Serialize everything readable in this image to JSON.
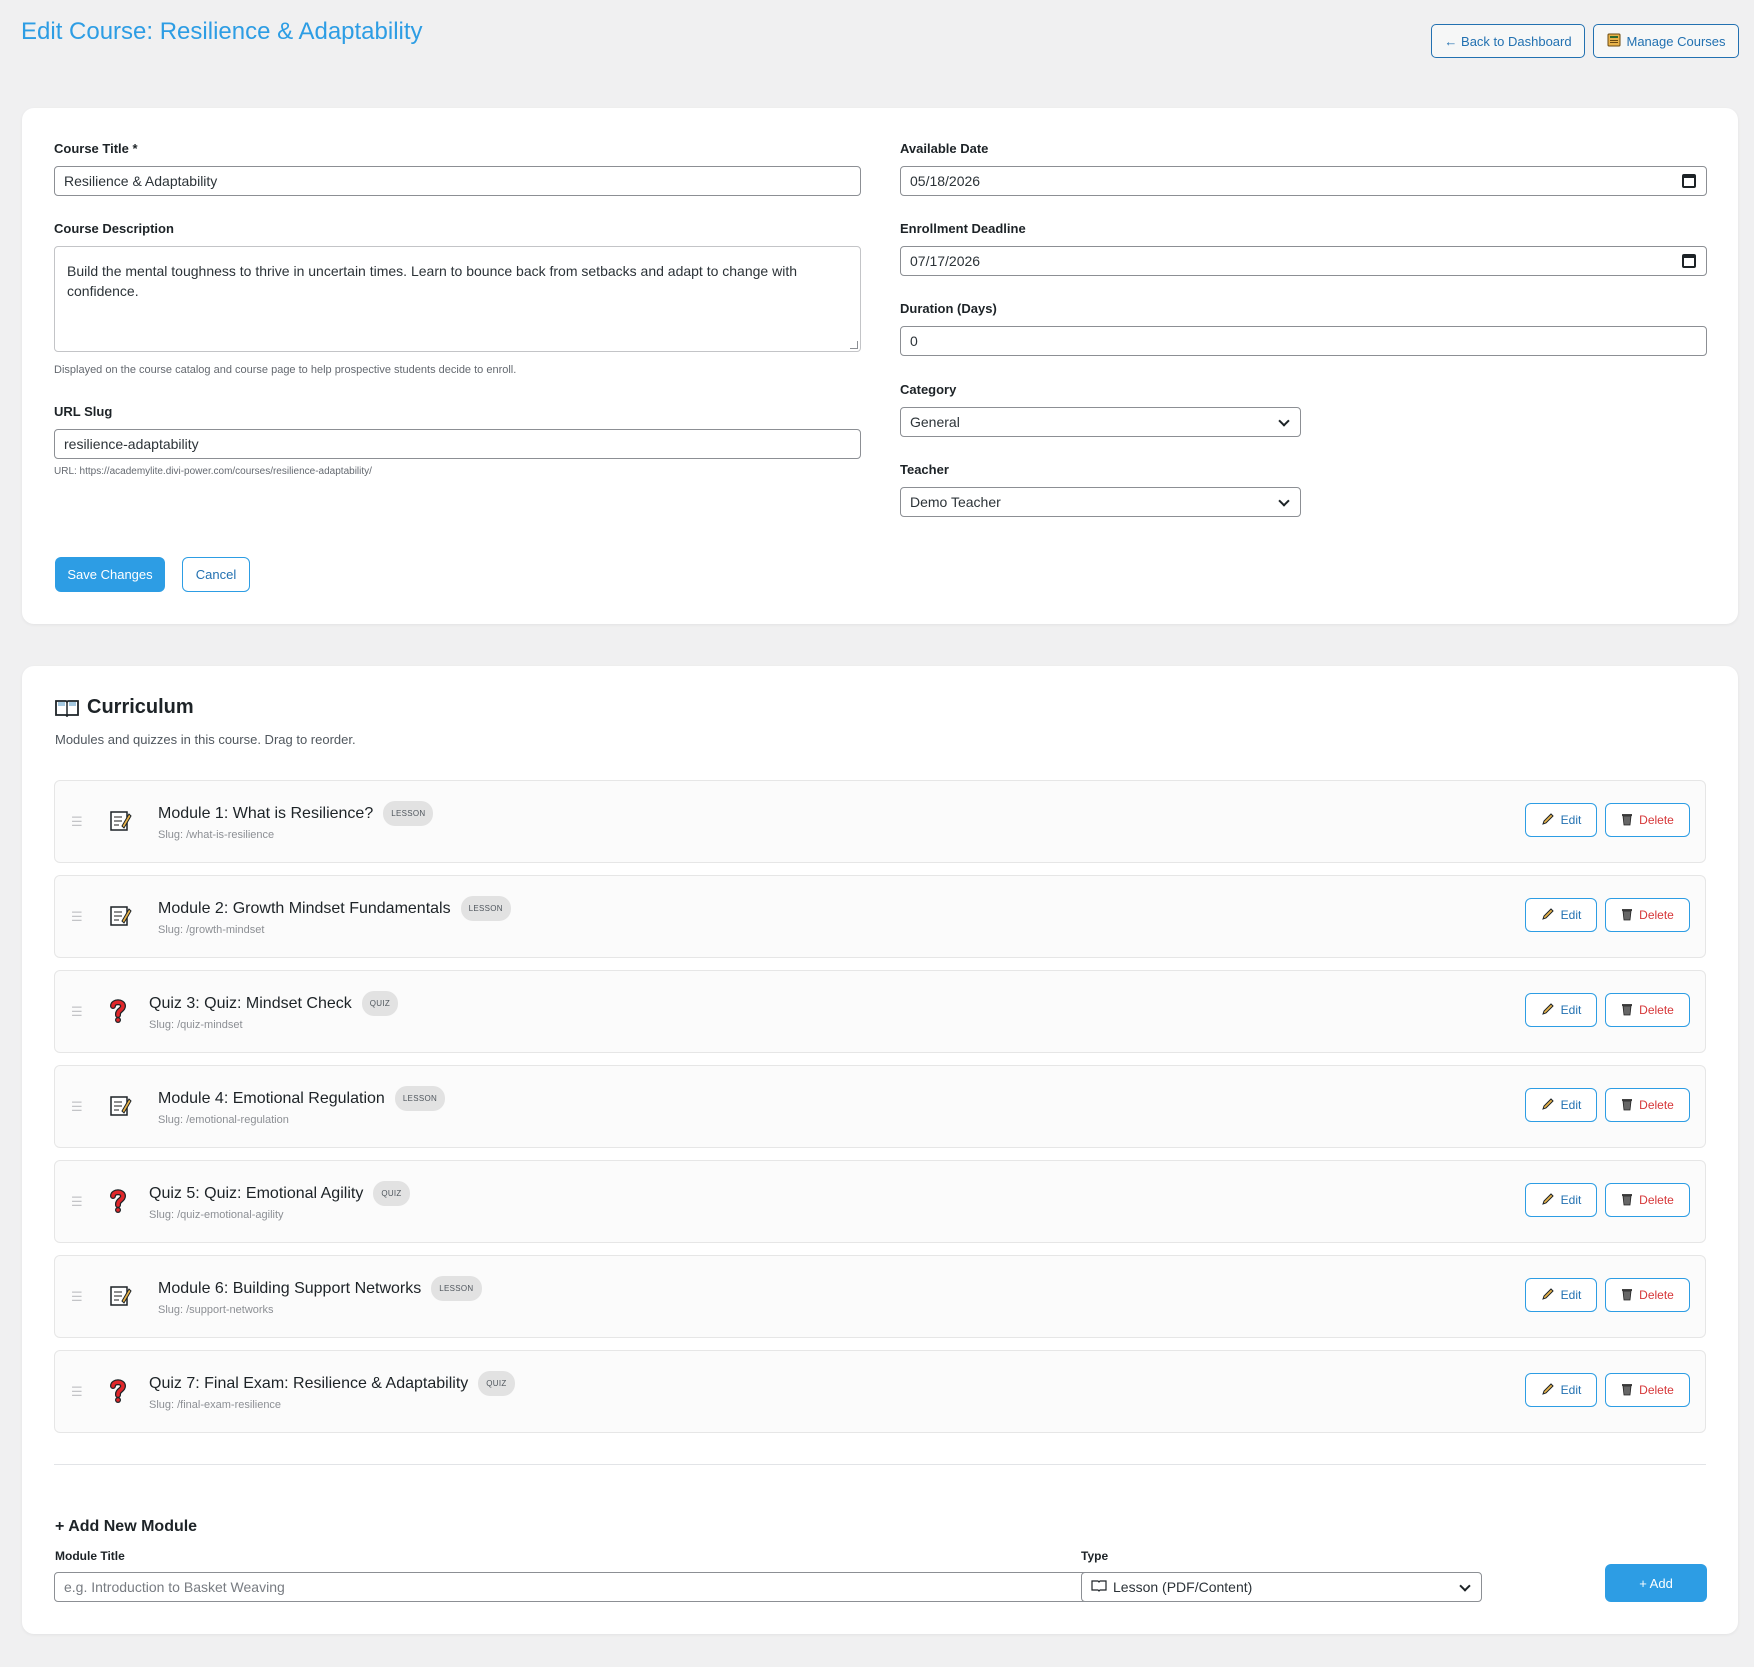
{
  "header": {
    "title": "Edit Course: Resilience & Adaptability",
    "back_label": "← Back to Dashboard",
    "manage_label": "Manage Courses"
  },
  "form": {
    "course_title_label": "Course Title *",
    "course_title_value": "Resilience & Adaptability",
    "description_label": "Course Description",
    "description_value": "Build the mental toughness to thrive in uncertain times. Learn to bounce back from setbacks and adapt to change with confidence.",
    "description_help": "Displayed on the course catalog and course page to help prospective students decide to enroll.",
    "slug_label": "URL Slug",
    "slug_value": "resilience-adaptability",
    "slug_help": "URL: https://academylite.divi-power.com/courses/resilience-adaptability/",
    "available_date_label": "Available Date",
    "available_date_value": "05/18/2026",
    "enrollment_deadline_label": "Enrollment Deadline",
    "enrollment_deadline_value": "07/17/2026",
    "duration_label": "Duration (Days)",
    "duration_value": "0",
    "category_label": "Category",
    "category_value": "General",
    "teacher_label": "Teacher",
    "teacher_value": "Demo Teacher",
    "save_label": "Save Changes",
    "cancel_label": "Cancel"
  },
  "curriculum": {
    "title": "Curriculum",
    "subtitle": "Modules and quizzes in this course. Drag to reorder.",
    "edit_label": "Edit",
    "delete_label": "Delete",
    "items": [
      {
        "title": "Module 1: What is Resilience?",
        "badge": "LESSON",
        "slug": "Slug: /what-is-resilience",
        "icon": "memo-icon"
      },
      {
        "title": "Module 2: Growth Mindset Fundamentals",
        "badge": "LESSON",
        "slug": "Slug: /growth-mindset",
        "icon": "memo-icon"
      },
      {
        "title": "Quiz 3: Quiz: Mindset Check",
        "badge": "QUIZ",
        "slug": "Slug: /quiz-mindset",
        "icon": "question-icon"
      },
      {
        "title": "Module 4: Emotional Regulation",
        "badge": "LESSON",
        "slug": "Slug: /emotional-regulation",
        "icon": "memo-icon"
      },
      {
        "title": "Quiz 5: Quiz: Emotional Agility",
        "badge": "QUIZ",
        "slug": "Slug: /quiz-emotional-agility",
        "icon": "question-icon"
      },
      {
        "title": "Module 6: Building Support Networks",
        "badge": "LESSON",
        "slug": "Slug: /support-networks",
        "icon": "memo-icon"
      },
      {
        "title": "Quiz 7: Final Exam: Resilience & Adaptability",
        "badge": "QUIZ",
        "slug": "Slug: /final-exam-resilience",
        "icon": "question-icon"
      }
    ]
  },
  "add_module": {
    "title": "+ Add New Module",
    "module_title_label": "Module Title",
    "module_title_placeholder": "e.g. Introduction to Basket Weaving",
    "type_label": "Type",
    "type_value": "Lesson (PDF/Content)",
    "add_label": "+ Add"
  },
  "colors": {
    "accent": "#2d9de4",
    "danger": "#d63638",
    "background": "#f0f0f1"
  }
}
